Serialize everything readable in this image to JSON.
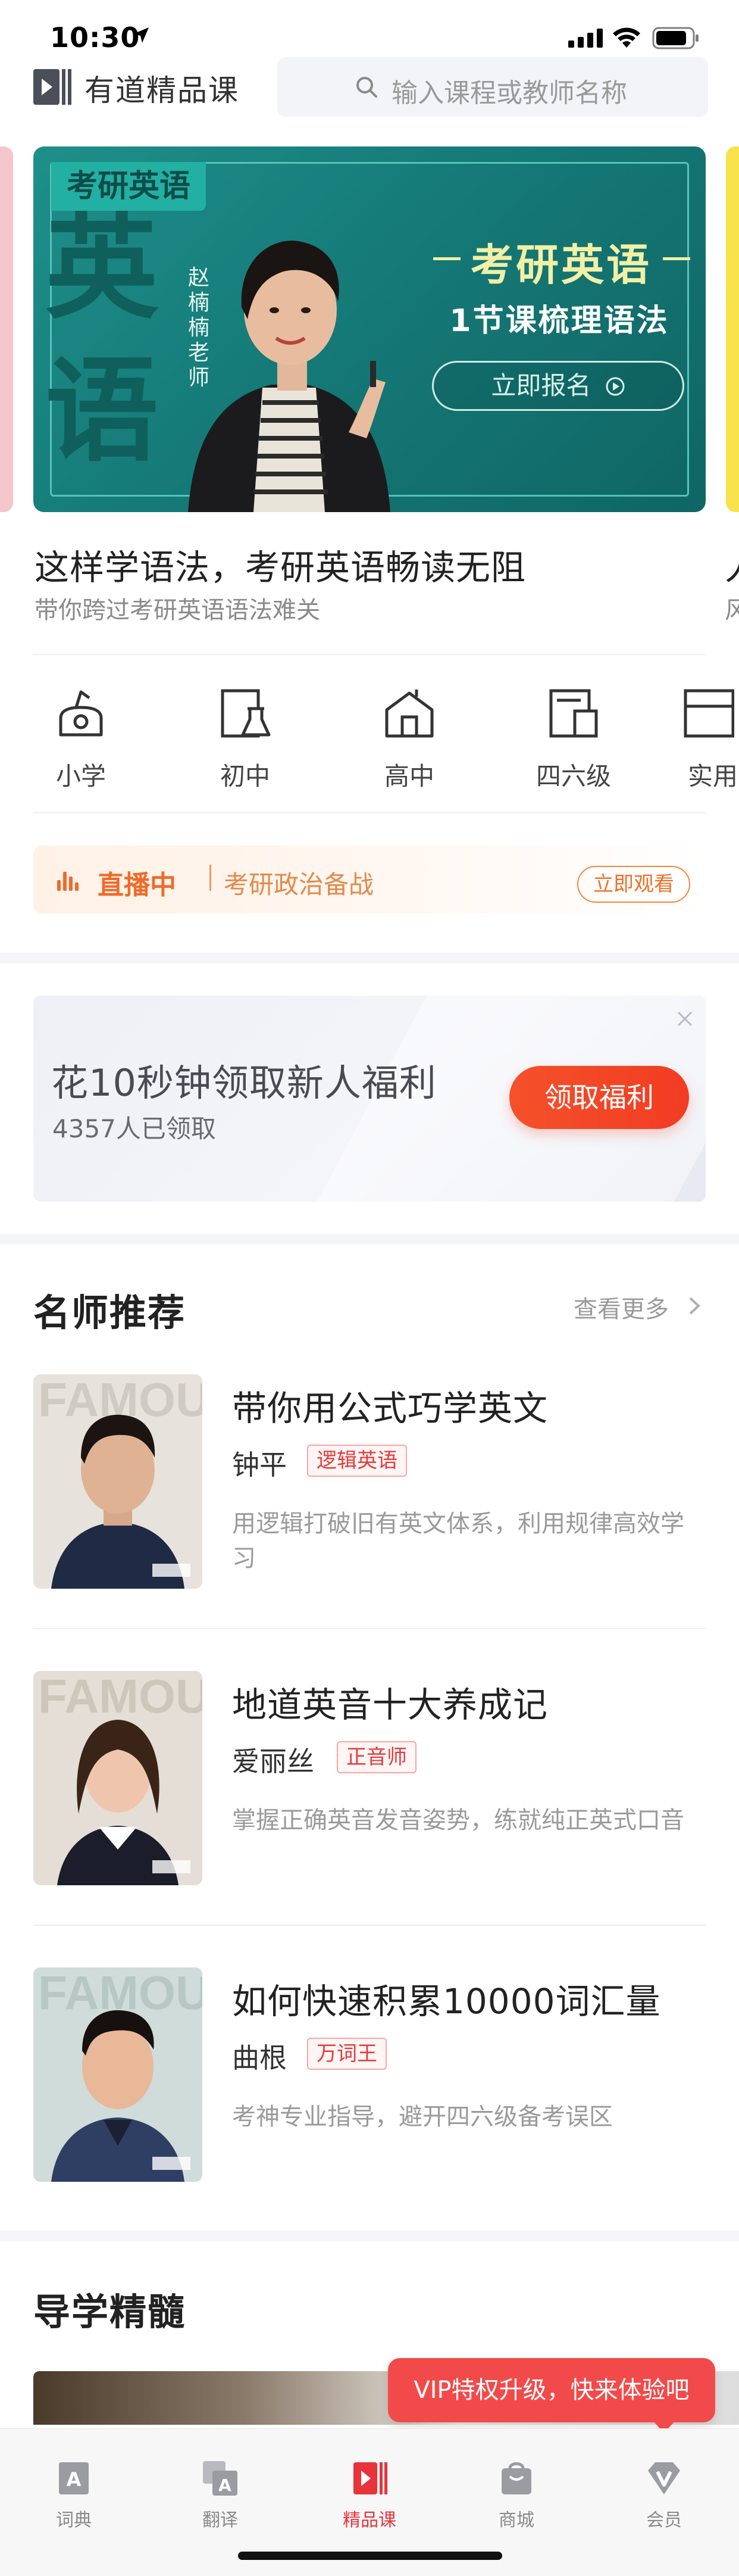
{
  "status_bar": {
    "time": "10:30"
  },
  "header": {
    "app_title": "有道精品课",
    "search_placeholder": "输入课程或教师名称"
  },
  "banner": {
    "tag": "考研英语",
    "big_chars": [
      "英",
      "语"
    ],
    "teacher_label": "赵楠楠老师",
    "headline_1": "考研英语",
    "headline_2": "1节课梳理语法",
    "signup_label": "立即报名",
    "title": "这样学语法，考研英语畅读无阻",
    "subtitle": "带你跨过考研英语语法难关",
    "peek_title": "人",
    "peek_subtitle": "风",
    "accent_color": "#1e8f8a"
  },
  "categories": [
    {
      "label": "小学",
      "icon": "school-bell-icon"
    },
    {
      "label": "初中",
      "icon": "flask-icon"
    },
    {
      "label": "高中",
      "icon": "building-icon"
    },
    {
      "label": "四六级",
      "icon": "document-icon"
    },
    {
      "label": "实用",
      "icon": "book-icon"
    }
  ],
  "live": {
    "status": "直播中",
    "course": "考研政治备战",
    "watch_label": "立即观看",
    "color": "#f06a2a"
  },
  "promo": {
    "title": "花10秒钟领取新人福利",
    "count_text": "4357人已领取",
    "button_label": "领取福利",
    "button_color": "#f23c23"
  },
  "teachers_section": {
    "title": "名师推荐",
    "see_more": "查看更多",
    "items": [
      {
        "course": "带你用公式巧学英文",
        "name": "钟平",
        "tag": "逻辑英语",
        "description": "用逻辑打破旧有英文体系，利用规律高效学习"
      },
      {
        "course": "地道英音十大养成记",
        "name": "爱丽丝",
        "tag": "正音师",
        "description": "掌握正确英音发音姿势，练就纯正英式口音"
      },
      {
        "course": "如何快速积累10000词汇量",
        "name": "曲根",
        "tag": "万词王",
        "description": "考神专业指导，避开四六级备考误区"
      }
    ]
  },
  "guide_section": {
    "title": "导学精髓"
  },
  "vip_toast": "VIP特权升级，快来体验吧",
  "tabbar": {
    "active_color": "#e8333a",
    "items": [
      {
        "label": "词典",
        "icon": "dictionary-icon"
      },
      {
        "label": "翻译",
        "icon": "translate-icon"
      },
      {
        "label": "精品课",
        "icon": "course-play-icon"
      },
      {
        "label": "商城",
        "icon": "shop-bag-icon"
      },
      {
        "label": "会员",
        "icon": "vip-badge-icon"
      }
    ]
  }
}
